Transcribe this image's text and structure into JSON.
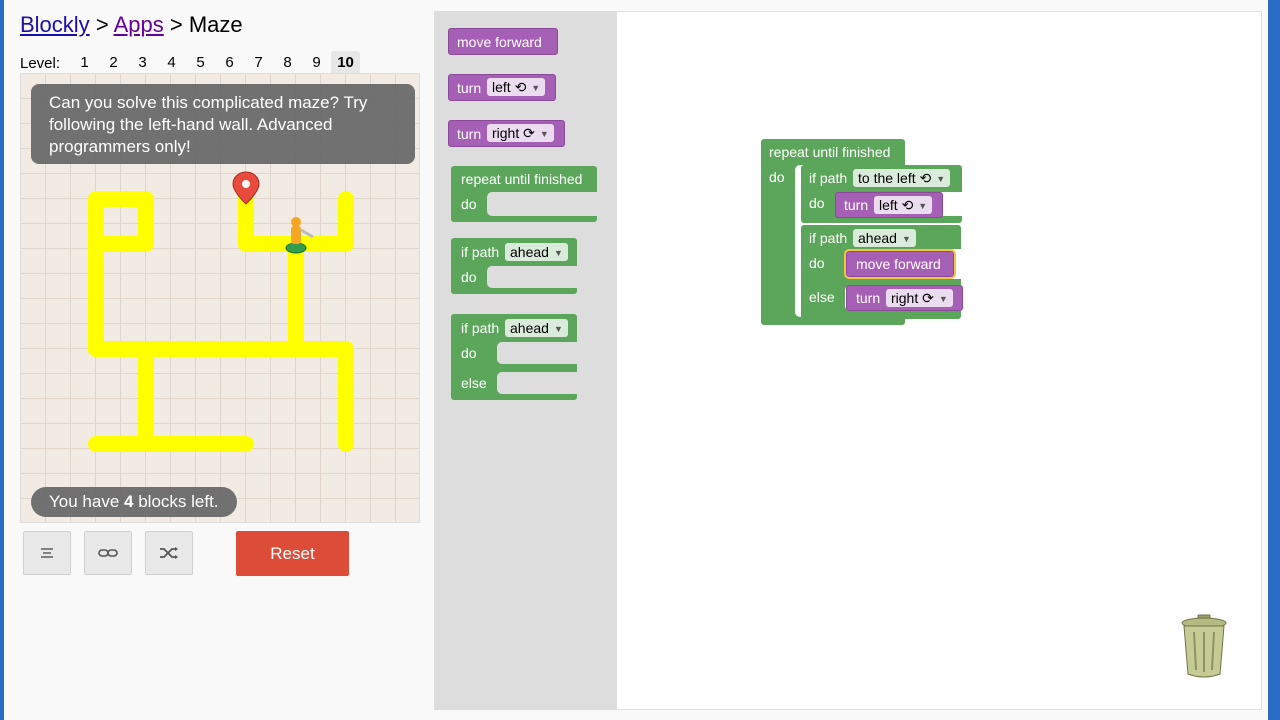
{
  "breadcrumb": {
    "root": "Blockly",
    "sep1": ">",
    "apps": "Apps",
    "sep2": ">",
    "current": "Maze"
  },
  "levels": {
    "label": "Level:",
    "items": [
      "1",
      "2",
      "3",
      "4",
      "5",
      "6",
      "7",
      "8",
      "9",
      "10"
    ],
    "current": "10"
  },
  "maze": {
    "hint": "Can you solve this complicated maze? Try following the left-hand wall. Advanced programmers only!",
    "blocks_left_prefix": "You have",
    "blocks_left_count": "4",
    "blocks_left_suffix": "blocks left."
  },
  "controls": {
    "code_icon": "code-icon",
    "link_icon": "link-icon",
    "random_icon": "shuffle-icon",
    "reset_label": "Reset",
    "reset_color": "#dd4b39"
  },
  "toolbox": {
    "move_forward": "move forward",
    "turn_left_word": "turn",
    "turn_left_value": "left ⟲",
    "turn_right_word": "turn",
    "turn_right_value": "right ⟳",
    "repeat_label": "repeat until finished",
    "do_label": "do",
    "if_path_label": "if path",
    "if_value": "ahead",
    "ifelse_label": "if path",
    "ifelse_value": "ahead",
    "ifelse_do": "do",
    "ifelse_else": "else",
    "if_do": "do",
    "repeat_do": "do"
  },
  "workspace": {
    "repeat_label": "repeat until finished",
    "repeat_do": "do",
    "if1_label": "if path",
    "if1_value": "to the left ⟲",
    "if1_do": "do",
    "turn1_word": "turn",
    "turn1_value": "left ⟲",
    "if2_label": "if path",
    "if2_value": "ahead",
    "if2_do": "do",
    "move_label": "move forward",
    "if2_else": "else",
    "turn2_word": "turn",
    "turn2_value": "right ⟳"
  },
  "colors": {
    "motion": "#a55fb4",
    "logic": "#5ba65b",
    "path": "#ffff00",
    "highlight": "#f5c542"
  }
}
